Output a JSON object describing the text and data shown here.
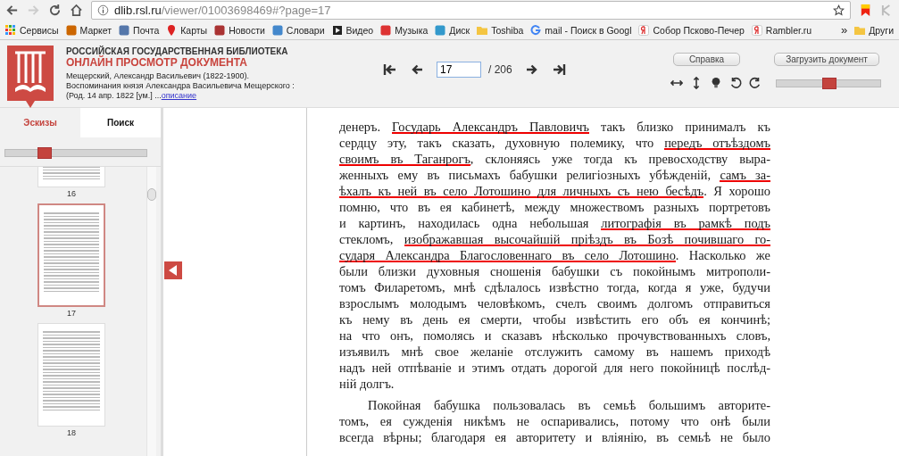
{
  "browser": {
    "url_host": "dlib.rsl.ru",
    "url_path": "/viewer/01003698469#?page=17",
    "forward_disabled": true,
    "bookmarks": [
      {
        "label": "Сервисы",
        "kind": "apps"
      },
      {
        "label": "Маркет",
        "kind": "market"
      },
      {
        "label": "Почта",
        "kind": "mail"
      },
      {
        "label": "Карты",
        "kind": "pin"
      },
      {
        "label": "Новости",
        "kind": "news"
      },
      {
        "label": "Словари",
        "kind": "book"
      },
      {
        "label": "Видео",
        "kind": "video"
      },
      {
        "label": "Музыка",
        "kind": "music"
      },
      {
        "label": "Диск",
        "kind": "disk"
      },
      {
        "label": "Toshiba",
        "kind": "folder"
      },
      {
        "label": "mail - Поиск в Googl",
        "kind": "google"
      },
      {
        "label": "Собор Псково-Печер",
        "kind": "yandex"
      },
      {
        "label": "Rambler.ru",
        "kind": "yandex"
      }
    ],
    "overflow": "»",
    "other_folder": "Други"
  },
  "header": {
    "org": "РОССИЙСКАЯ ГОСУДАРСТВЕННАЯ БИБЛИОТЕКА",
    "title": "ОНЛАЙН ПРОСМОТР ДОКУМЕНТА",
    "description": [
      "Мещерский, Александр Васильевич (1822-1900).",
      "Воспоминания князя Александра Васильевича Мещерского :",
      "(Род. 14 апр. 1822 [ум.] ..."
    ],
    "description_link": "описание",
    "page_input": "17",
    "page_total": "/ 206",
    "help_button": "Справка",
    "download_button": "Загрузить документ",
    "zoom": {
      "level": 0.5
    }
  },
  "sidebar": {
    "tabs": [
      {
        "label": "Эскизы",
        "selected": true
      },
      {
        "label": "Поиск",
        "selected": false
      }
    ],
    "size_slider": {
      "level": 0.27
    },
    "thumbnails": [
      {
        "label": "16",
        "selected": false,
        "cut": true
      },
      {
        "label": "17",
        "selected": true,
        "cut": false
      },
      {
        "label": "18",
        "selected": false,
        "cut": false
      }
    ]
  },
  "page": {
    "paragraphs": [
      {
        "indent": false,
        "ends": true,
        "lines": [
          [
            {
              "t": "денеръ. ",
              "u": false
            },
            {
              "t": "Государь Александръ Павловичъ",
              "u": true
            },
            {
              "t": " такъ близко принималъ къ",
              "u": false
            }
          ],
          [
            {
              "t": "сердцу эту, такъ сказать, духовную полемику, что ",
              "u": false
            },
            {
              "t": "передъ отъѣздомъ",
              "u": true
            }
          ],
          [
            {
              "t": "своимъ въ Таганрогъ",
              "u": true
            },
            {
              "t": ", склоняясь уже тогда къ превосходству выра-",
              "u": false
            }
          ],
          [
            {
              "t": "женныхъ ему въ письмахъ бабушки религіозныхъ убѣжденій, ",
              "u": false
            },
            {
              "t": "самъ за-",
              "u": true
            }
          ],
          [
            {
              "t": "ѣхалъ къ ней въ село Лотошино для личныхъ съ нею бесѣдъ",
              "u": true
            },
            {
              "t": ". Я хорошо",
              "u": false
            }
          ],
          [
            {
              "t": "помню, что въ ея кабинетѣ, между множествомъ разныхъ портретовъ",
              "u": false
            }
          ],
          [
            {
              "t": "и картинъ, находилась одна небольшая ",
              "u": false
            },
            {
              "t": "литографія въ рамкѣ подъ",
              "u": true
            }
          ],
          [
            {
              "t": "стекломъ, ",
              "u": false
            },
            {
              "t": "изображавшая высочайшій пріѣздъ въ Бозѣ почившаго го-",
              "u": true
            }
          ],
          [
            {
              "t": "сударя Александра Благословеннаго въ село Лотошино",
              "u": true
            },
            {
              "t": ". Насколько же",
              "u": false
            }
          ],
          [
            {
              "t": "были близки духовныя сношенія бабушки съ покойнымъ митрополи-",
              "u": false
            }
          ],
          [
            {
              "t": "томъ Филаретомъ, мнѣ сдѣлалось извѣстно тогда, когда я уже, будучи",
              "u": false
            }
          ],
          [
            {
              "t": "взрослымъ молодымъ человѣкомъ, счелъ своимъ долгомъ отправиться",
              "u": false
            }
          ],
          [
            {
              "t": "къ нему въ день ея смерти, чтобы извѣстить его объ ея кончинѣ;",
              "u": false
            }
          ],
          [
            {
              "t": "на что онъ, помолясь и сказавъ нѣсколько прочувствованныхъ словъ,",
              "u": false
            }
          ],
          [
            {
              "t": "изъявилъ мнѣ свое желаніе отслужить самому въ нашемъ приходѣ",
              "u": false
            }
          ],
          [
            {
              "t": "надъ ней отпѣваніе и этимъ отдать дорогой для него покойницѣ послѣд-",
              "u": false
            }
          ],
          [
            {
              "t": "ній долгъ.",
              "u": false
            }
          ]
        ]
      },
      {
        "indent": true,
        "ends": false,
        "lines": [
          [
            {
              "t": "Покойная бабушка пользовалась въ семьѣ большимъ авторите-",
              "u": false
            }
          ],
          [
            {
              "t": "томъ, ея сужденія никѣмъ не оспаривались, потому что онѣ были",
              "u": false
            }
          ],
          [
            {
              "t": "всегда вѣрны; благодаря ея авторитету и вліянію, въ семьѣ не было",
              "u": false
            }
          ]
        ]
      }
    ]
  }
}
